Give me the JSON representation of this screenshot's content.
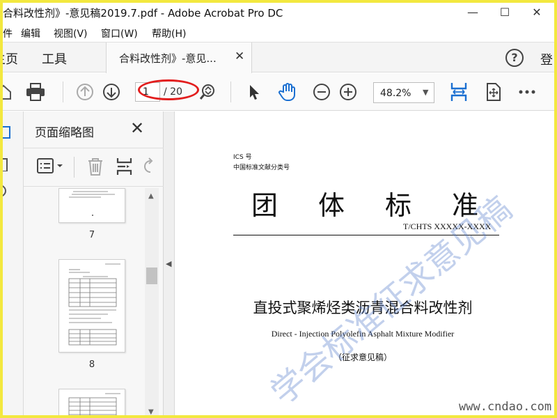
{
  "window": {
    "title": "合料改性剂》-意见稿2019.7.pdf - Adobe Acrobat Pro DC",
    "minimize": "—",
    "maximize": "☐",
    "close": "✕"
  },
  "menu": {
    "items": [
      "件",
      "编辑",
      "视图(V)",
      "窗口(W)",
      "帮助(H)"
    ]
  },
  "tabs": {
    "home": "主页",
    "tools": "工具",
    "doc_tab_label": "合料改性剂》-意见...",
    "doc_tab_close": "✕",
    "help": "?",
    "login": "登"
  },
  "toolbar": {
    "current_page": "1",
    "total_pages": "/ 20",
    "zoom": "48.2%",
    "zoom_caret": "▼"
  },
  "panel": {
    "title": "页面缩略图",
    "close": "✕",
    "thumbnails": [
      {
        "page": "7"
      },
      {
        "page": "8"
      }
    ]
  },
  "document": {
    "ics": "ICS 号",
    "classification": "中国标准文献分类号",
    "big_chars": [
      "团",
      "体",
      "标",
      "准"
    ],
    "standard_no": "T/CHTS XXXXX-XXXX",
    "title_cn": "直投式聚烯烃类沥青混合料改性剂",
    "title_en": "Direct - Injection Polyolefin Asphalt Mixture Modifier",
    "draft": "（征求意见稿）",
    "watermark": "学会标准征求意见稿",
    "site": "www.cndao.com"
  },
  "colors": {
    "frame": "#f3e83f",
    "annotation_oval": "#e21d1d",
    "accent_blue": "#1a6fd1"
  }
}
